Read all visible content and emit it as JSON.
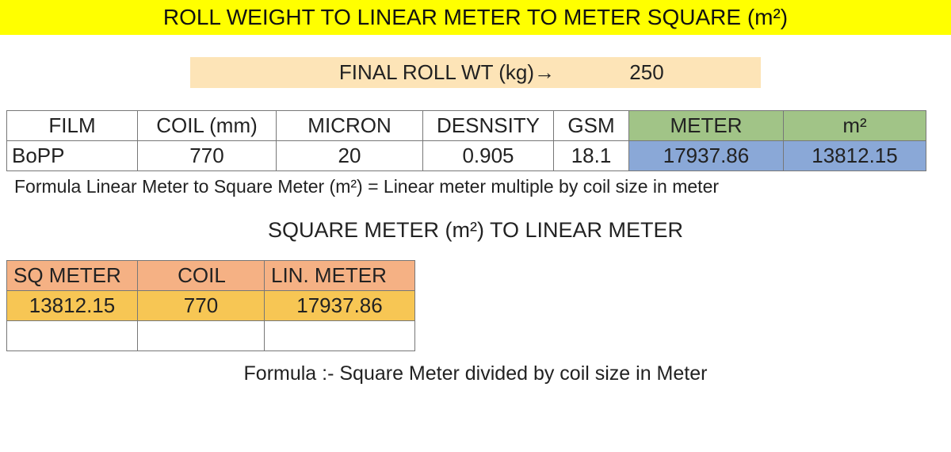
{
  "title": "ROLL WEIGHT TO LINEAR METER TO METER SQUARE (m²)",
  "final_roll": {
    "label": "FINAL ROLL WT (kg)→",
    "value": "250"
  },
  "table1": {
    "headers": {
      "film": "FILM",
      "coil": "COIL (mm)",
      "micron": "MICRON",
      "density": "DESNSITY",
      "gsm": "GSM",
      "meter": "METER",
      "m2": "m²"
    },
    "row": {
      "film": "BoPP",
      "coil": "770",
      "micron": "20",
      "density": "0.905",
      "gsm": "18.1",
      "meter": "17937.86",
      "m2": "13812.15"
    }
  },
  "formula1": "Formula Linear Meter to Square Meter (m²) = Linear meter multiple by coil size in meter",
  "section2_title": "SQUARE METER (m²) TO LINEAR METER",
  "table2": {
    "headers": {
      "sq": "SQ METER",
      "coil": "COIL",
      "lin": "LIN. METER"
    },
    "row": {
      "sq": "13812.15",
      "coil": "770",
      "lin": "17937.86"
    }
  },
  "formula2": "Formula :- Square Meter divided by coil size in Meter"
}
